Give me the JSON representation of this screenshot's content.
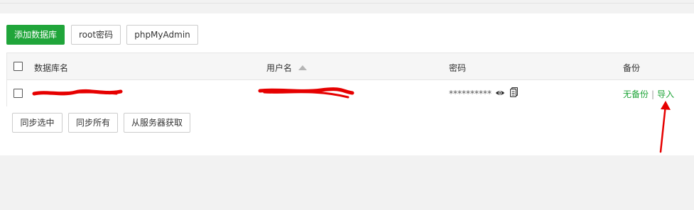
{
  "toolbar": {
    "add_database_label": "添加数据库",
    "root_password_label": "root密码",
    "phpmyadmin_label": "phpMyAdmin"
  },
  "table": {
    "columns": {
      "name": "数据库名",
      "username": "用户名",
      "password": "密码",
      "backup": "备份"
    },
    "rows": [
      {
        "name": "",
        "username": "",
        "password_masked": "**********",
        "backup_status": "无备份",
        "separator": "|",
        "import_label": "导入"
      }
    ]
  },
  "actions": {
    "sync_selected_label": "同步选中",
    "sync_all_label": "同步所有",
    "fetch_from_server_label": "从服务器获取"
  },
  "colors": {
    "primary_green": "#20a53a",
    "annotation_red": "#e60000"
  },
  "icons": {
    "sort": "sort-ascending-icon",
    "eye": "eye-icon",
    "copy": "copy-icon",
    "arrow": "annotation-arrow-icon"
  }
}
